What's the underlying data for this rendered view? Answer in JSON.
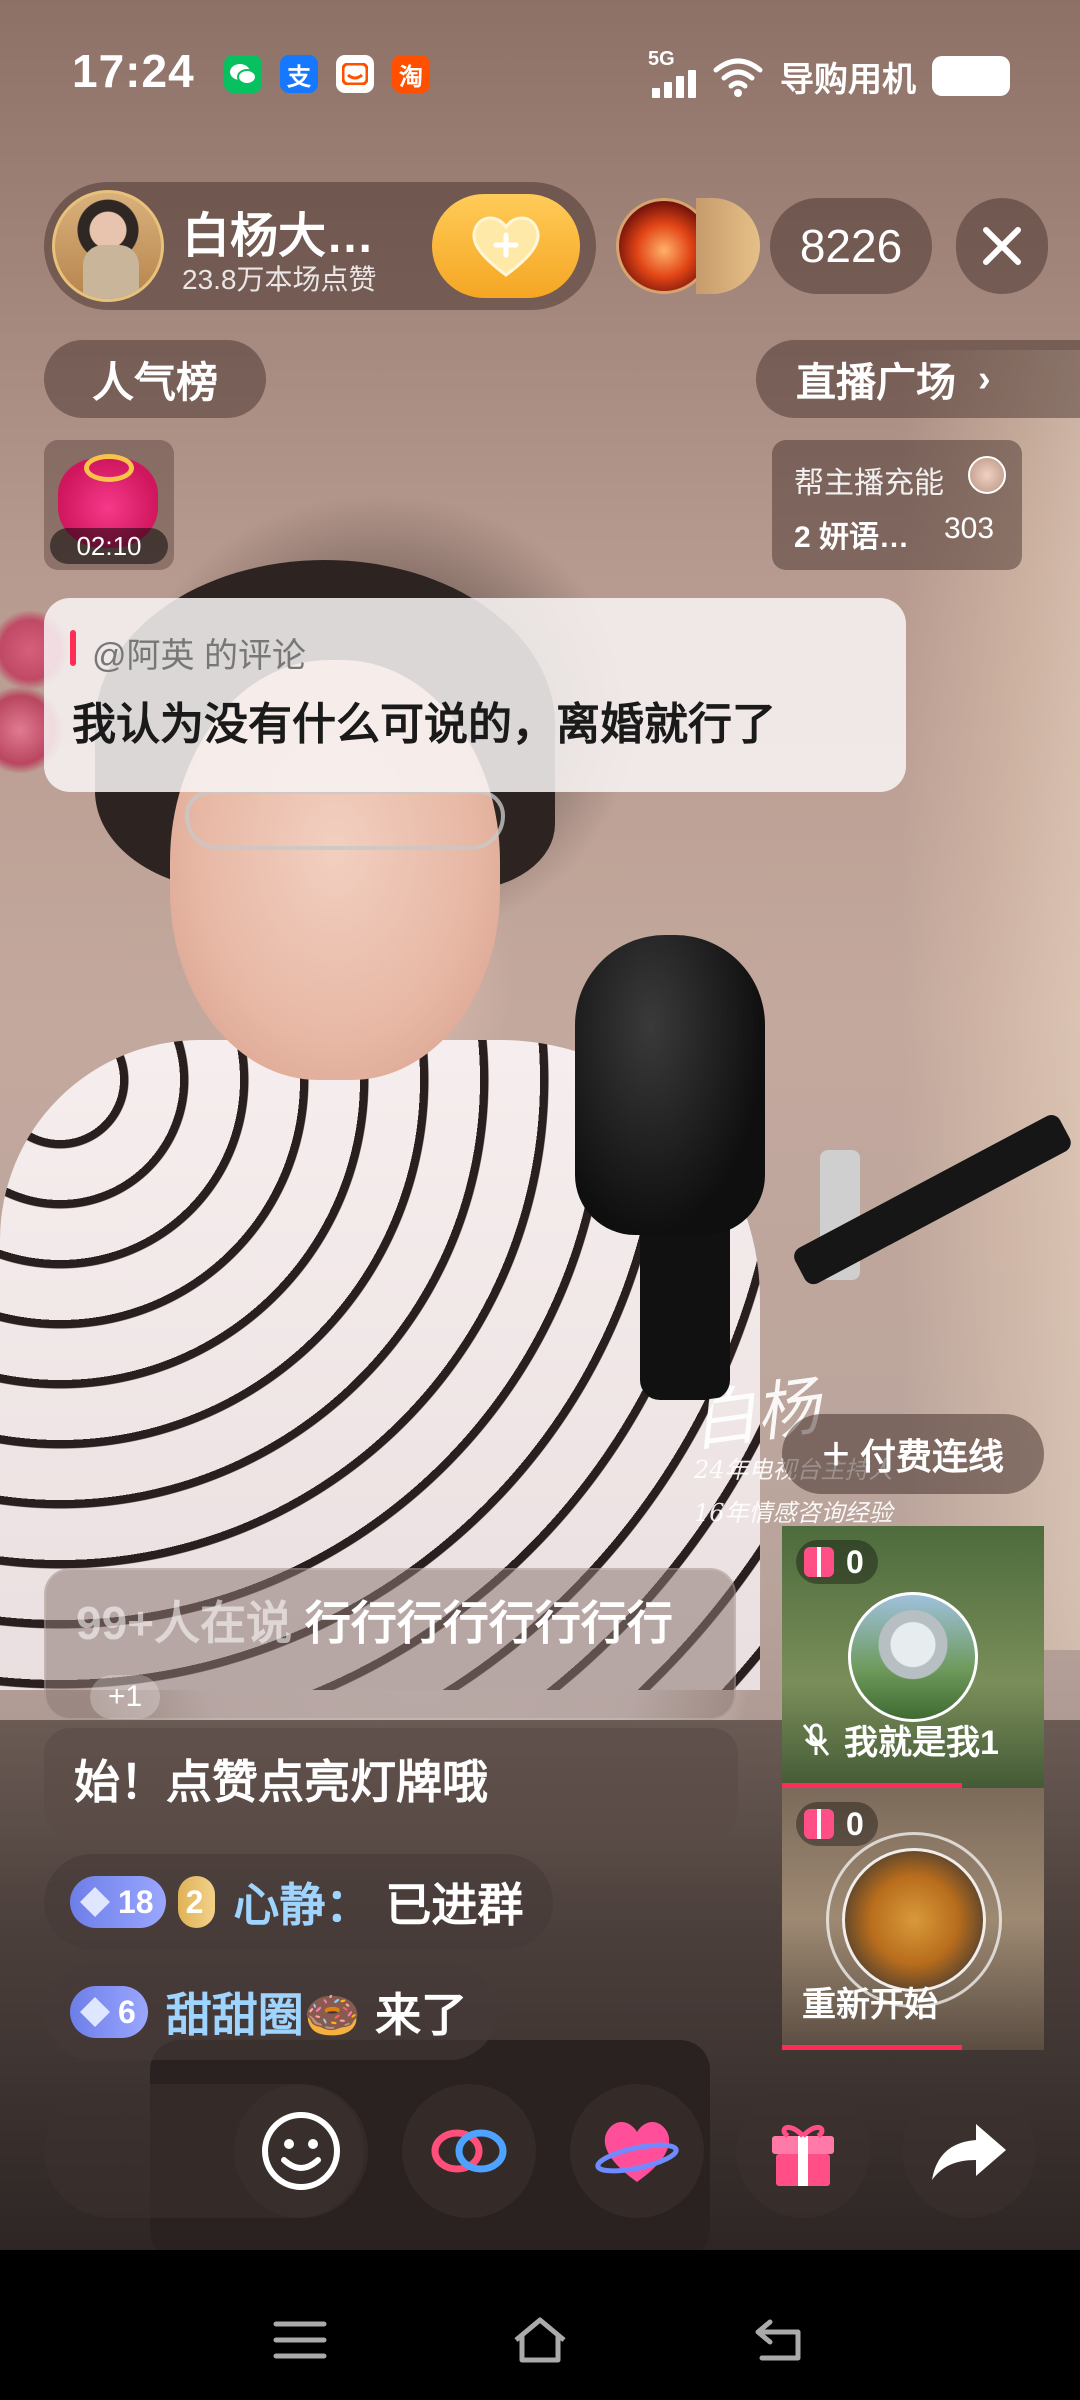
{
  "status_bar": {
    "time": "17:24",
    "network": "5G",
    "carrier": "导购用机",
    "icons": [
      "wechat-icon",
      "alipay-icon",
      "app-icon",
      "taobao-icon"
    ]
  },
  "anchor": {
    "name": "白杨大…",
    "likes": "23.8万本场点赞",
    "follow_icon": "heart-plus-icon"
  },
  "viewers": {
    "count": "8226"
  },
  "top_buttons": {
    "rank": "人气榜",
    "plaza": "直播广场",
    "plaza_chevron": "›"
  },
  "lucky_bag": {
    "timer": "02:10"
  },
  "charge": {
    "title": "帮主播充能",
    "user": "2 妍语…",
    "score": "303"
  },
  "pinned_comment": {
    "author": "@阿英 的评论",
    "text": "我认为没有什么可说的，离婚就行了"
  },
  "watermark": {
    "name": "白杨",
    "line1": "24年电视台主持人",
    "line2": "16年情感咨询经验"
  },
  "paid_link": {
    "label": "付费连线"
  },
  "chat": {
    "floating": {
      "count_text": "99+人在说",
      "message": "行行行行行行行行",
      "plus": "+1"
    },
    "system": {
      "text": "始！点赞点亮灯牌哦"
    },
    "messages": [
      {
        "level": "18",
        "fan_level": "2",
        "user": "心静：",
        "text": "已进群"
      },
      {
        "level": "6",
        "user": "甜甜圈🍩",
        "text": "来了"
      }
    ]
  },
  "cohosts": [
    {
      "gifts": "0",
      "name": "我就是我1",
      "muted": true
    },
    {
      "gifts": "0",
      "name": "重新开始",
      "muted": false
    }
  ],
  "actions": [
    "emoji-icon",
    "link-icon",
    "heart-planet-icon",
    "gift-icon",
    "share-icon"
  ],
  "colors": {
    "accent": "#ff2d55",
    "follow": "#f5a623",
    "username": "#9fd4ff"
  }
}
